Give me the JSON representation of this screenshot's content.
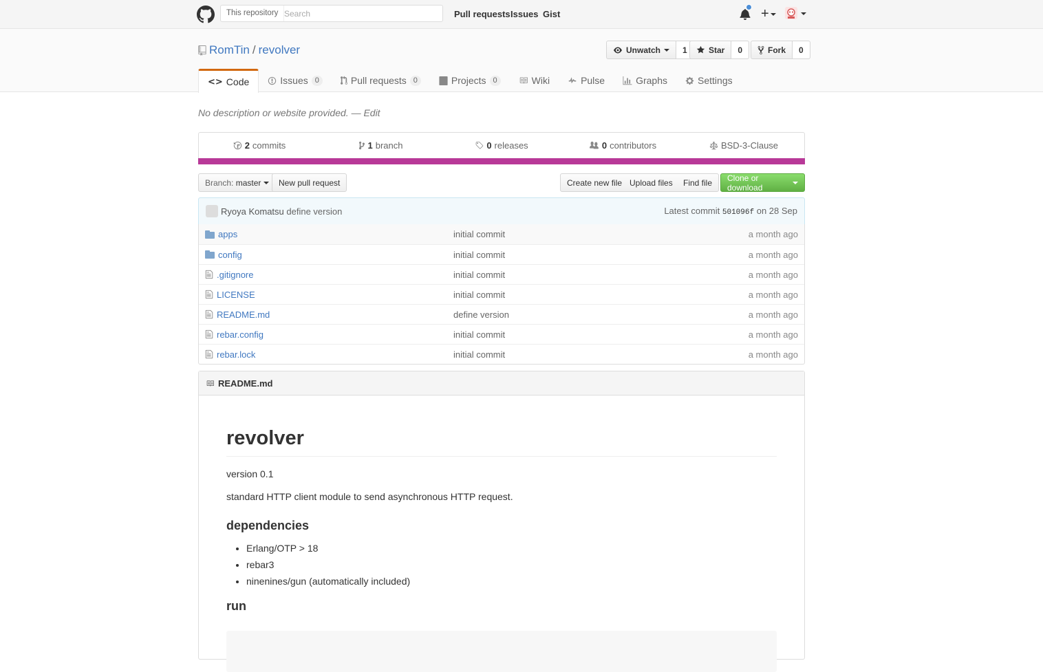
{
  "header": {
    "search_scope": "This repository",
    "search_placeholder": "Search",
    "nav": [
      "Pull requests",
      "Issues",
      "Gist"
    ]
  },
  "repo": {
    "owner": "RomTin",
    "name": "revolver",
    "separator": "/",
    "watch_label": "Unwatch",
    "watch_count": "1",
    "star_label": "Star",
    "star_count": "0",
    "fork_label": "Fork",
    "fork_count": "0"
  },
  "tabs": [
    {
      "label": "Code",
      "count": ""
    },
    {
      "label": "Issues",
      "count": "0"
    },
    {
      "label": "Pull requests",
      "count": "0"
    },
    {
      "label": "Projects",
      "count": "0"
    },
    {
      "label": "Wiki",
      "count": ""
    },
    {
      "label": "Pulse",
      "count": ""
    },
    {
      "label": "Graphs",
      "count": ""
    },
    {
      "label": "Settings",
      "count": ""
    }
  ],
  "description": {
    "text": "No description or website provided.",
    "edit": "— Edit"
  },
  "summary": {
    "commits_n": "2",
    "commits_label": "commits",
    "branch_n": "1",
    "branch_label": "branch",
    "releases_n": "0",
    "releases_label": "releases",
    "contributors_n": "0",
    "contributors_label": "contributors",
    "license": "BSD-3-Clause",
    "language_color": "#b83998"
  },
  "actions": {
    "branch_prefix": "Branch:",
    "branch": "master",
    "new_pr": "New pull request",
    "create_file": "Create new file",
    "upload": "Upload files",
    "find": "Find file",
    "clone": "Clone or download"
  },
  "commit": {
    "author": "Ryoya Komatsu",
    "message": "define version",
    "latest_label": "Latest commit",
    "sha": "501096f",
    "date": "on 28 Sep"
  },
  "files": [
    {
      "name": "apps",
      "type": "folder",
      "message": "initial commit",
      "age": "a month ago"
    },
    {
      "name": "config",
      "type": "folder",
      "message": "initial commit",
      "age": "a month ago"
    },
    {
      "name": ".gitignore",
      "type": "file",
      "message": "initial commit",
      "age": "a month ago"
    },
    {
      "name": "LICENSE",
      "type": "file",
      "message": "initial commit",
      "age": "a month ago"
    },
    {
      "name": "README.md",
      "type": "file",
      "message": "define version",
      "age": "a month ago"
    },
    {
      "name": "rebar.config",
      "type": "file",
      "message": "initial commit",
      "age": "a month ago"
    },
    {
      "name": "rebar.lock",
      "type": "file",
      "message": "initial commit",
      "age": "a month ago"
    }
  ],
  "readme": {
    "filename": "README.md",
    "title": "revolver",
    "version": "version 0.1",
    "summary": "standard HTTP client module to send asynchronous HTTP request.",
    "deps_heading": "dependencies",
    "deps": [
      "Erlang/OTP > 18",
      "rebar3",
      "ninenines/gun (automatically included)"
    ],
    "run_heading": "run"
  }
}
